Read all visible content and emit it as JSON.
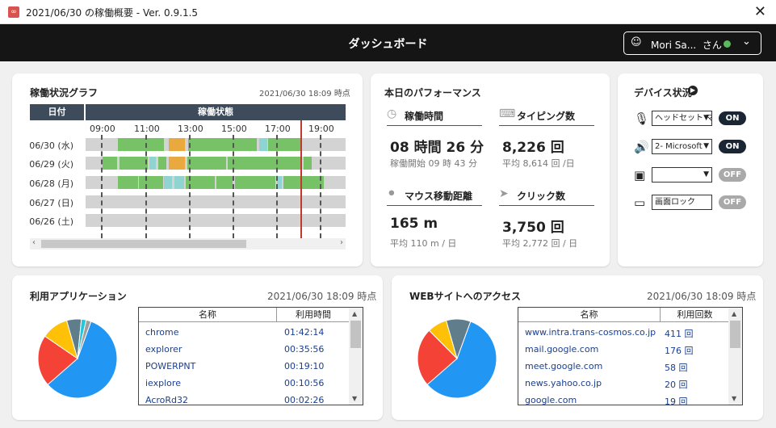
{
  "window": {
    "title": "2021/06/30 の稼働概要 - Ver. 0.9.1.5",
    "close": "✕"
  },
  "header": {
    "title": "ダッシュボード",
    "user_name": "Mori Sa...",
    "user_suffix": "さん",
    "status_color": "#5cb85c"
  },
  "timeline": {
    "title": "稼働状況グラフ",
    "timestamp": "2021/06/30 18:09 時点",
    "col_date": "日付",
    "col_status": "稼働状態",
    "hours": [
      "09:00",
      "11:00",
      "13:00",
      "15:00",
      "17:00",
      "19:00"
    ],
    "rows": [
      {
        "label": "06/30 (水)"
      },
      {
        "label": "06/29 (火)"
      },
      {
        "label": "06/28 (月)"
      },
      {
        "label": "06/27 (日)"
      },
      {
        "label": "06/26 (土)"
      }
    ],
    "colors": {
      "active": "#77c267",
      "meeting": "#e9a93f",
      "light": "#8fd4d0",
      "idle": "#d3d3d3",
      "now_line": "#c0392b"
    }
  },
  "performance": {
    "title": "本日のパフォーマンス",
    "work_time": {
      "label": "稼働時間",
      "value": "08 時間 26 分",
      "sub": "稼働開始 09 時 43 分"
    },
    "typing": {
      "label": "タイピング数",
      "value": "8,226 回",
      "sub": "平均 8,614 回 /日"
    },
    "mouse": {
      "label": "マウス移動距離",
      "value": "165 m",
      "sub": "平均 110 m / 日"
    },
    "clicks": {
      "label": "クリック数",
      "value": "3,750 回",
      "sub": "平均 2,772 回 / 日"
    }
  },
  "devices": {
    "title": "デバイス状況",
    "items": [
      {
        "icon": "microphone-icon",
        "select": "ヘッドセット マ",
        "state": "ON"
      },
      {
        "icon": "speaker-icon",
        "select": "2- Microsoft",
        "state": "ON"
      },
      {
        "icon": "camera-icon",
        "select": "",
        "state": "OFF"
      },
      {
        "icon": "screen-icon",
        "select": "画面ロック",
        "state": "OFF"
      }
    ]
  },
  "apps": {
    "title": "利用アプリケーション",
    "timestamp": "2021/06/30 18:09 時点",
    "col_name": "名称",
    "col_time": "利用時間",
    "rows": [
      {
        "name": "chrome",
        "time": "01:42:14"
      },
      {
        "name": "explorer",
        "time": "00:35:56"
      },
      {
        "name": "POWERPNT",
        "time": "00:19:10"
      },
      {
        "name": "iexplore",
        "time": "00:10:56"
      },
      {
        "name": "AcroRd32",
        "time": "00:02:26"
      }
    ],
    "pie": [
      {
        "value": 58,
        "color": "#2196f3"
      },
      {
        "value": 21,
        "color": "#f44336"
      },
      {
        "value": 11,
        "color": "#ffc107"
      },
      {
        "value": 6,
        "color": "#607d8b"
      },
      {
        "value": 2,
        "color": "#26c6da"
      },
      {
        "value": 2,
        "color": "#9e9e9e"
      }
    ]
  },
  "websites": {
    "title": "WEBサイトへのアクセス",
    "timestamp": "2021/06/30 18:09 時点",
    "col_name": "名称",
    "col_count": "利用回数",
    "rows": [
      {
        "name": "www.intra.trans-cosmos.co.jp",
        "count": "411 回"
      },
      {
        "name": "mail.google.com",
        "count": "176 回"
      },
      {
        "name": "meet.google.com",
        "count": "58 回"
      },
      {
        "name": "news.yahoo.co.jp",
        "count": "20 回"
      },
      {
        "name": "google.com",
        "count": "19 回"
      }
    ],
    "pie": [
      {
        "value": 58,
        "color": "#2196f3"
      },
      {
        "value": 24,
        "color": "#f44336"
      },
      {
        "value": 8,
        "color": "#ffc107"
      },
      {
        "value": 10,
        "color": "#607d8b"
      }
    ]
  }
}
